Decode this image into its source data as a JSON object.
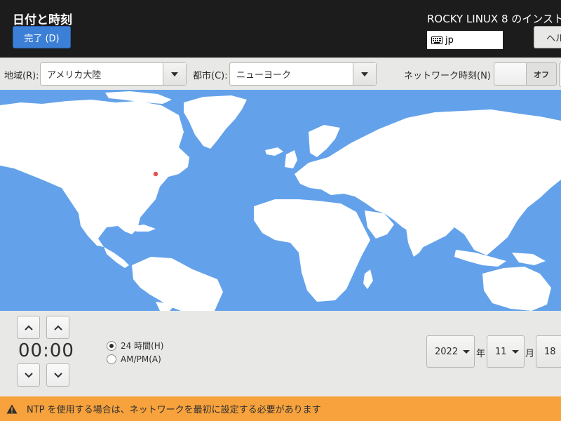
{
  "header": {
    "title": "日付と時刻",
    "done_button": "完了 (D)",
    "product_title": "ROCKY LINUX 8 のインスト",
    "keyboard_layout": "jp",
    "help_button": "ヘル"
  },
  "toolbar": {
    "region_label": "地域(R):",
    "region_value": "アメリカ大陸",
    "city_label": "都市(C):",
    "city_value": "ニューヨーク",
    "network_time_label": "ネットワーク時刻(N)",
    "network_time_state": "オフ"
  },
  "time": {
    "display": "00:00",
    "format_24h_label": "24 時間(H)",
    "format_ampm_label": "AM/PM(A)",
    "format_selected": "24h"
  },
  "date": {
    "year": "2022",
    "year_suffix": "年",
    "month": "11",
    "month_suffix": "月",
    "day": "18"
  },
  "warning": {
    "text": "NTP を使用する場合は、ネットワークを最初に設定する必要があります"
  },
  "colors": {
    "header_bg": "#1c1c1c",
    "accent_blue": "#3c7fd6",
    "map_ocean": "#63a2ea",
    "map_land": "#ffffff",
    "marker": "#e05252",
    "warning_bg": "#f7a23d"
  }
}
